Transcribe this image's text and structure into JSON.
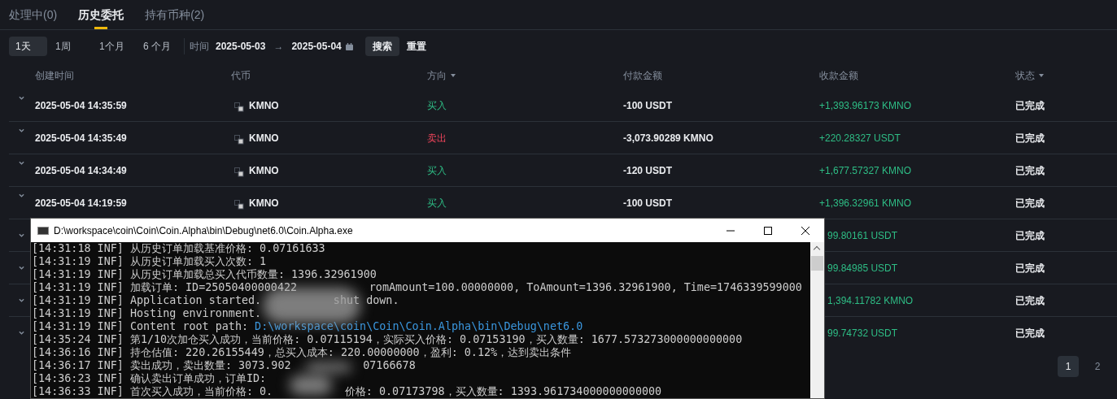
{
  "tabs": [
    {
      "label": "处理中(0)",
      "selected": false
    },
    {
      "label": "历史委托",
      "selected": true
    },
    {
      "label": "持有币种(2)",
      "selected": false
    }
  ],
  "filters": {
    "periods": [
      {
        "label": "1天",
        "selected": true
      },
      {
        "label": "1周",
        "selected": false
      },
      {
        "label": "1个月",
        "selected": false
      },
      {
        "label": "6 个月",
        "selected": false
      }
    ],
    "time_label": "时间",
    "start_date": "2025-05-03",
    "arrow": "→",
    "end_date": "2025-05-04",
    "search_button": "搜索",
    "reset_button": "重置"
  },
  "table": {
    "columns": [
      {
        "label": "创建时间",
        "sortable": false
      },
      {
        "label": "代币",
        "sortable": false
      },
      {
        "label": "方向",
        "sortable": true
      },
      {
        "label": "付款金额",
        "sortable": false
      },
      {
        "label": "收款金额",
        "sortable": false
      },
      {
        "label": "状态",
        "sortable": true
      }
    ],
    "rows": [
      {
        "time": "2025-05-04 14:35:59",
        "coin": "KMNO",
        "side": "买入",
        "kind": "buy",
        "paid": "-100 USDT",
        "received": "+1,393.96173 KMNO",
        "status": "已完成"
      },
      {
        "time": "2025-05-04 14:35:49",
        "coin": "KMNO",
        "side": "卖出",
        "kind": "sell",
        "paid": "-3,073.90289 KMNO",
        "received": "+220.28327 USDT",
        "status": "已完成"
      },
      {
        "time": "2025-05-04 14:34:49",
        "coin": "KMNO",
        "side": "买入",
        "kind": "buy",
        "paid": "-120 USDT",
        "received": "+1,677.57327 KMNO",
        "status": "已完成"
      },
      {
        "time": "2025-05-04 14:19:59",
        "coin": "KMNO",
        "side": "买入",
        "kind": "buy",
        "paid": "-100 USDT",
        "received": "+1,396.32961 KMNO",
        "status": "已完成"
      },
      {
        "received": "99.80161 USDT",
        "status": "已完成"
      },
      {
        "received": "99.84985 USDT",
        "status": "已完成"
      },
      {
        "received": "1,394.11782 KMNO",
        "status": "已完成"
      },
      {
        "received": "99.74732 USDT",
        "status": "已完成"
      }
    ]
  },
  "pagination": [
    {
      "label": "1",
      "selected": true
    },
    {
      "label": "2",
      "selected": false
    }
  ],
  "console": {
    "title": "D:\\workspace\\coin\\Coin\\Coin.Alpha\\bin\\Debug\\net6.0\\Coin.Alpha.exe",
    "lines": [
      {
        "segments": [
          {
            "text": "[14:31:18 INF] 从历史订单加载基准价格: 0.07161633"
          }
        ]
      },
      {
        "segments": [
          {
            "text": "[14:31:19 INF] 从历史订单加载买入次数: 1"
          }
        ]
      },
      {
        "segments": [
          {
            "text": "[14:31:19 INF] 从历史订单加载总买入代币数量: 1396.32961900"
          }
        ]
      },
      {
        "segments": [
          {
            "text": "[14:31:19 INF] 加载订单: ID=25050400000422"
          },
          {
            "kind": "gap"
          },
          {
            "text": "romAmount=100.00000000, ToAmount=1396.32961900, Time=1746339599000"
          }
        ]
      },
      {
        "segments": [
          {
            "text": "[14:31:19 INF] Application started."
          },
          {
            "kind": "gap"
          },
          {
            "text": "shut down."
          }
        ]
      },
      {
        "segments": [
          {
            "text": "[14:31:19 INF] Hosting environment."
          }
        ]
      },
      {
        "segments": [
          {
            "text": "[14:31:19 INF] Content root path: "
          },
          {
            "kind": "path",
            "text": "D:\\workspace\\coin\\Coin\\Coin.Alpha\\bin\\Debug\\net6.0"
          }
        ]
      },
      {
        "segments": [
          {
            "text": "[14:35:24 INF] 第1/10次加仓买入成功，当前价格: 0.07115194，实际买入价格: 0.07153190，买入数量: 1677.573273000000000000"
          }
        ]
      },
      {
        "segments": [
          {
            "text": "[14:36:16 INF] 持仓估值: 220.26155449，总买入成本: 220.00000000，盈利: 0.12%，达到卖出条件"
          }
        ]
      },
      {
        "segments": [
          {
            "text": "[14:36:17 INF] 卖出成功，卖出数量: 3073.902"
          },
          {
            "kind": "gap"
          },
          {
            "text": "07166678"
          }
        ]
      },
      {
        "segments": [
          {
            "text": "[14:36:23 INF] 确认卖出订单成功，订单ID:"
          }
        ]
      },
      {
        "segments": [
          {
            "text": "[14:36:33 INF] 首次买入成功，当前价格: 0."
          },
          {
            "kind": "gap"
          },
          {
            "text": "价格: 0.07173798，买入数量: 1393.961734000000000000"
          }
        ]
      }
    ]
  }
}
